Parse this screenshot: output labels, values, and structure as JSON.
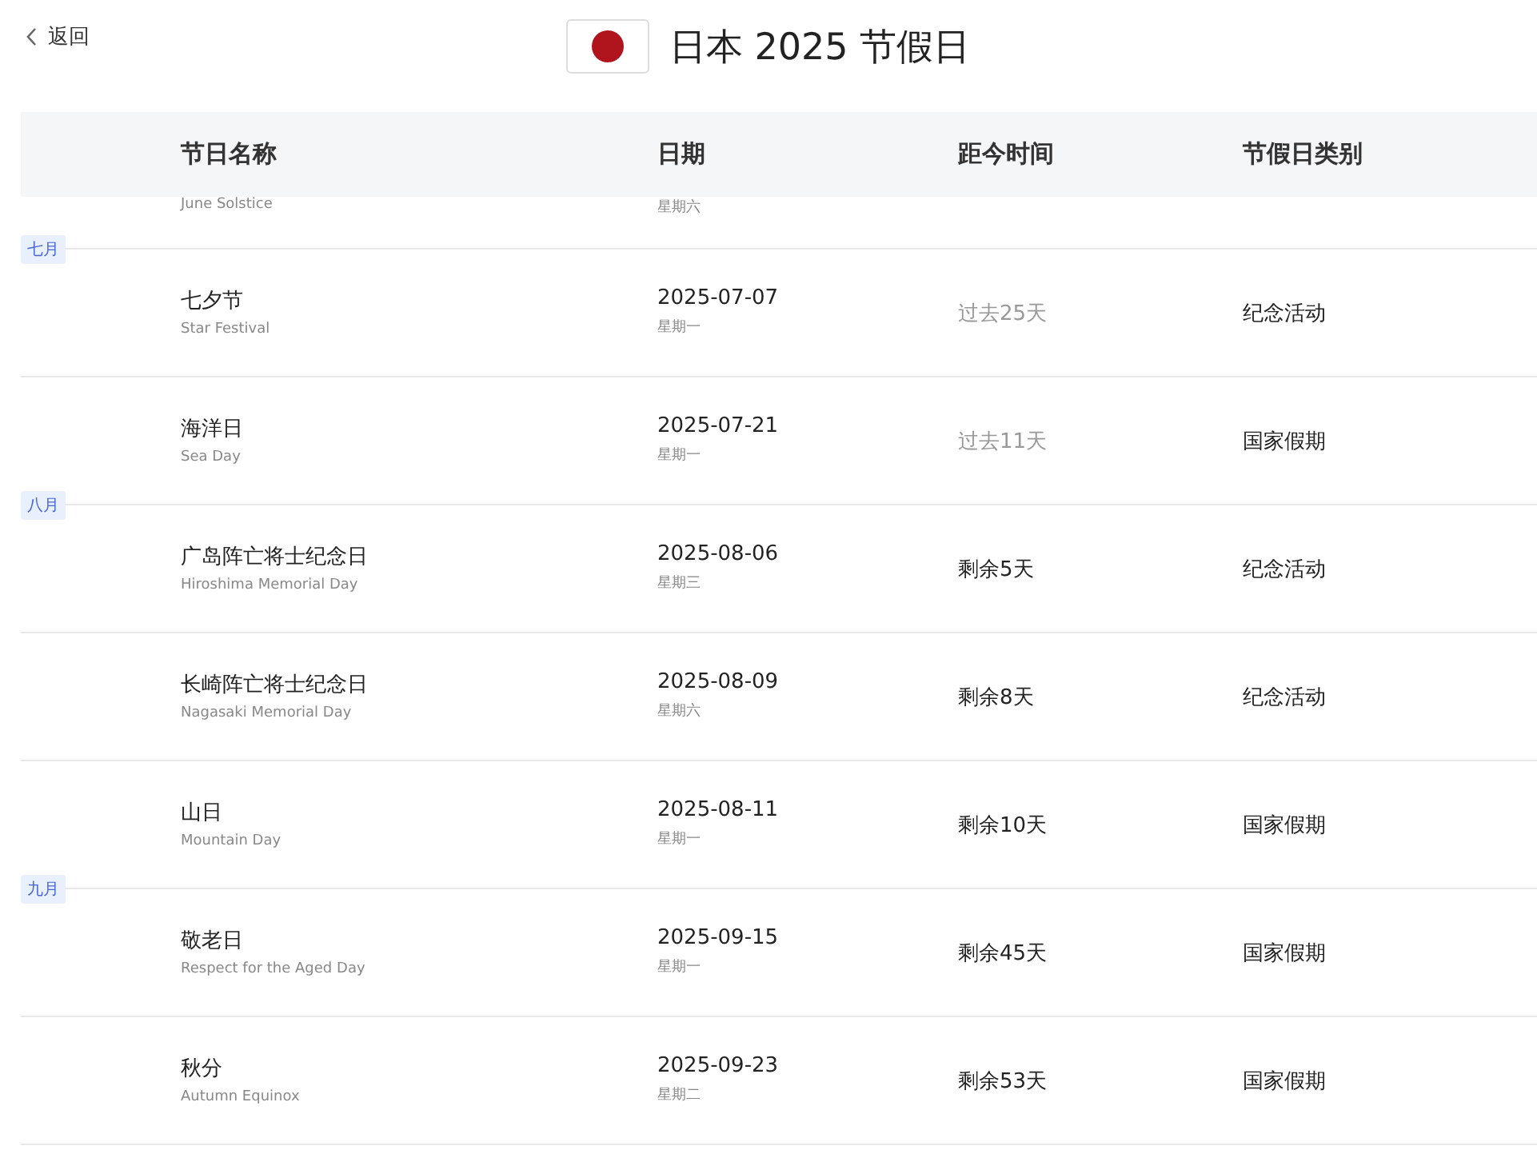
{
  "back_link": {
    "label": "返回"
  },
  "title": "日本 2025 节假日",
  "table": {
    "columns": [
      "节日名称",
      "日期",
      "距今时间",
      "节假日类别"
    ],
    "rows": [
      {
        "english": "June Solstice",
        "weekday": "星期六"
      },
      {
        "month_tag": "七月",
        "name": "七夕节",
        "english": "Star Festival",
        "date": "2025-07-07",
        "weekday": "星期一",
        "countdown": "过去25天",
        "past": true,
        "category": "纪念活动"
      },
      {
        "name": "海洋日",
        "english": "Sea Day",
        "date": "2025-07-21",
        "weekday": "星期一",
        "countdown": "过去11天",
        "past": true,
        "category": "国家假期"
      },
      {
        "month_tag": "八月",
        "name": "广岛阵亡将士纪念日",
        "english": "Hiroshima Memorial Day",
        "date": "2025-08-06",
        "weekday": "星期三",
        "countdown": "剩余5天",
        "past": false,
        "category": "纪念活动"
      },
      {
        "name": "长崎阵亡将士纪念日",
        "english": "Nagasaki Memorial Day",
        "date": "2025-08-09",
        "weekday": "星期六",
        "countdown": "剩余8天",
        "past": false,
        "category": "纪念活动"
      },
      {
        "name": "山日",
        "english": "Mountain Day",
        "date": "2025-08-11",
        "weekday": "星期一",
        "countdown": "剩余10天",
        "past": false,
        "category": "国家假期"
      },
      {
        "month_tag": "九月",
        "name": "敬老日",
        "english": "Respect for the Aged Day",
        "date": "2025-09-15",
        "weekday": "星期一",
        "countdown": "剩余45天",
        "past": false,
        "category": "国家假期"
      },
      {
        "name": "秋分",
        "english": "Autumn Equinox",
        "date": "2025-09-23",
        "weekday": "星期二",
        "countdown": "剩余53天",
        "past": false,
        "category": "国家假期"
      }
    ]
  }
}
